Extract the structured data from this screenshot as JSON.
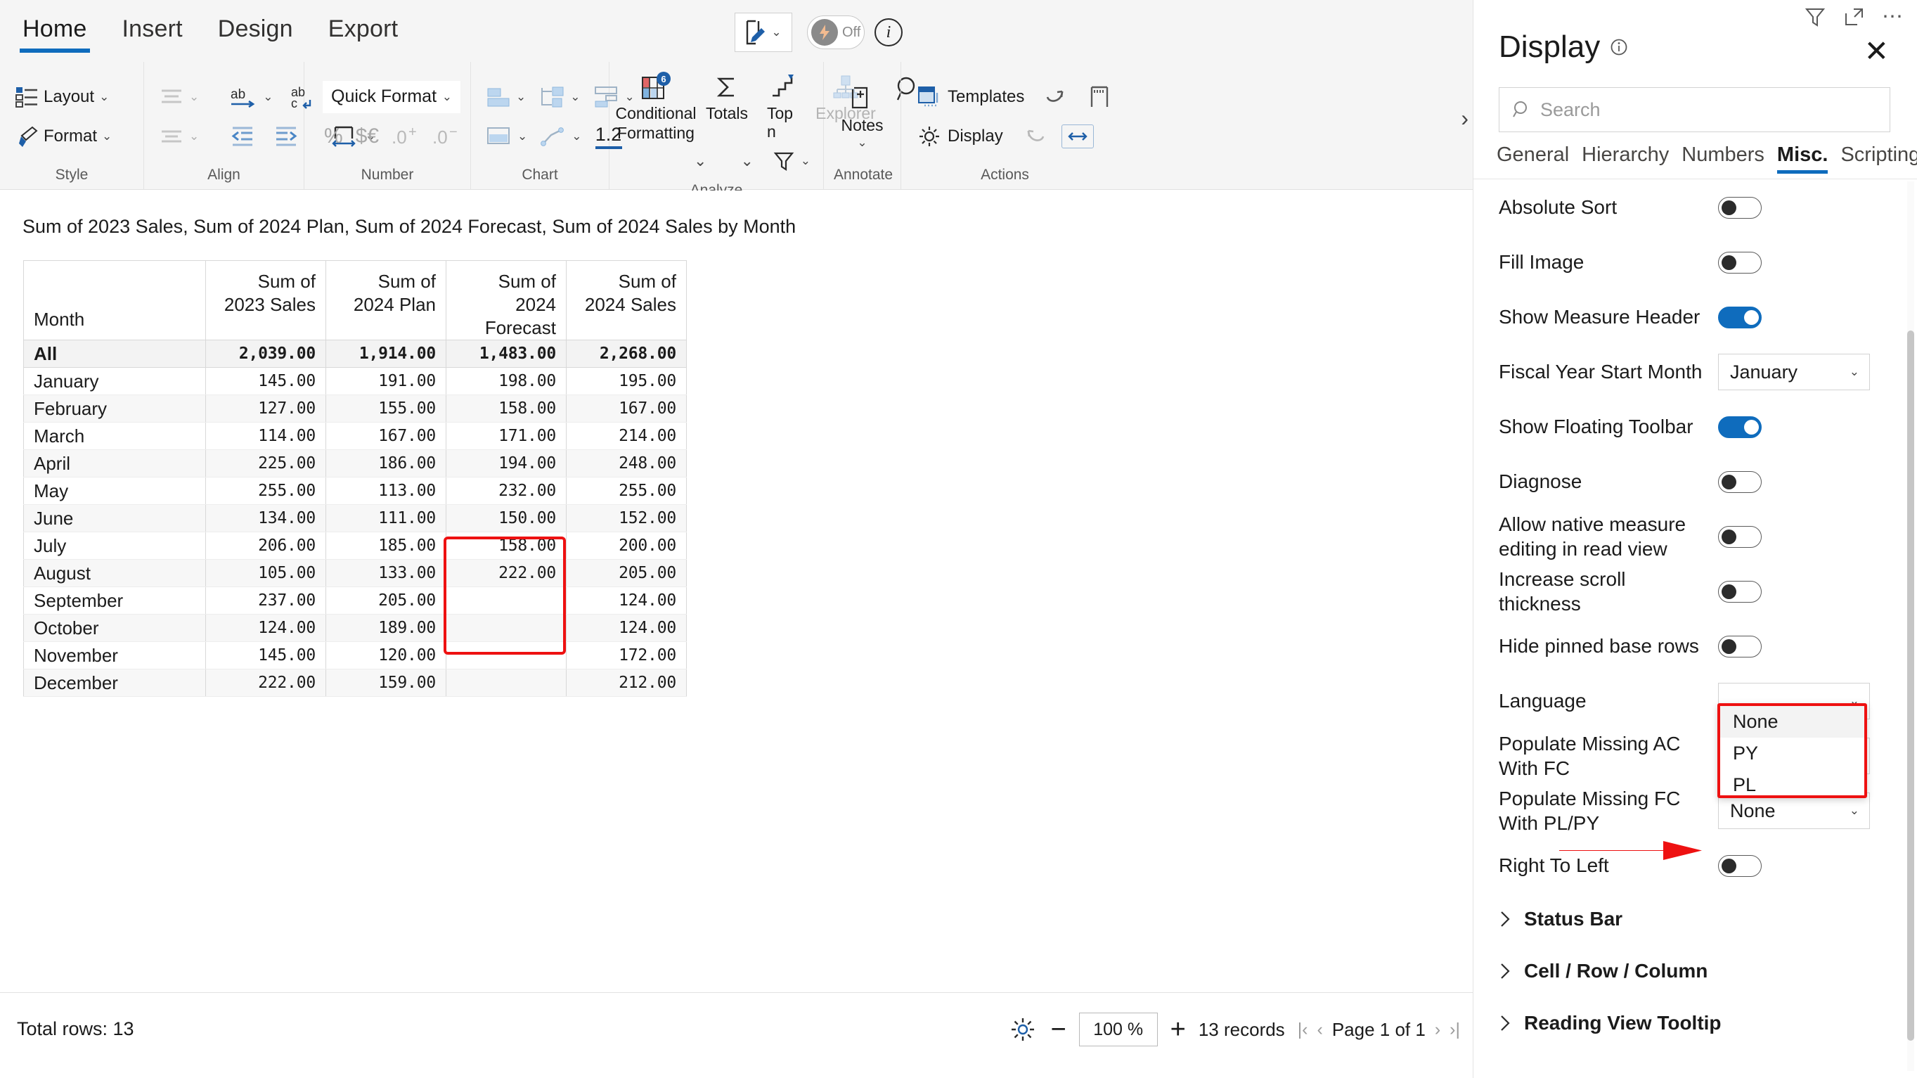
{
  "ribbon": {
    "tabs": [
      {
        "label": "Home",
        "active": true
      },
      {
        "label": "Insert",
        "active": false
      },
      {
        "label": "Design",
        "active": false
      },
      {
        "label": "Export",
        "active": false
      }
    ],
    "groups": {
      "style": {
        "label": "Style",
        "layout": "Layout",
        "format": "Format"
      },
      "align": {
        "label": "Align",
        "font_size": "18"
      },
      "number": {
        "label": "Number",
        "quick_format": "Quick Format"
      },
      "chart": {
        "label": "Chart",
        "one_two": "1.2"
      },
      "analyze": {
        "label": "Analyze",
        "conditional_formatting": "Conditional Formatting",
        "conditional_badge": "6",
        "totals": "Totals",
        "topn": "Top n",
        "explorer": "Explorer"
      },
      "annotate": {
        "label": "Annotate",
        "notes": "Notes"
      },
      "actions": {
        "label": "Actions",
        "templates": "Templates",
        "display": "Display"
      }
    },
    "quick_toolbar": {
      "off_label": "Off"
    }
  },
  "canvas": {
    "visual_title": "Sum of 2023 Sales, Sum of 2024 Plan, Sum of 2024 Forecast, Sum of 2024 Sales by Month"
  },
  "chart_data": {
    "type": "table",
    "title": "Sum of 2023 Sales, Sum of 2024 Plan, Sum of 2024 Forecast, Sum of 2024 Sales by Month",
    "columns": [
      "Month",
      "Sum of 2023 Sales",
      "Sum of 2024 Plan",
      "Sum of 2024 Forecast",
      "Sum of 2024 Sales"
    ],
    "rows": [
      {
        "month": "All",
        "s2023": "2,039.00",
        "plan": "1,914.00",
        "forecast": "1,483.00",
        "s2024": "2,268.00",
        "total": true
      },
      {
        "month": "January",
        "s2023": "145.00",
        "plan": "191.00",
        "forecast": "198.00",
        "s2024": "195.00"
      },
      {
        "month": "February",
        "s2023": "127.00",
        "plan": "155.00",
        "forecast": "158.00",
        "s2024": "167.00"
      },
      {
        "month": "March",
        "s2023": "114.00",
        "plan": "167.00",
        "forecast": "171.00",
        "s2024": "214.00"
      },
      {
        "month": "April",
        "s2023": "225.00",
        "plan": "186.00",
        "forecast": "194.00",
        "s2024": "248.00"
      },
      {
        "month": "May",
        "s2023": "255.00",
        "plan": "113.00",
        "forecast": "232.00",
        "s2024": "255.00"
      },
      {
        "month": "June",
        "s2023": "134.00",
        "plan": "111.00",
        "forecast": "150.00",
        "s2024": "152.00"
      },
      {
        "month": "July",
        "s2023": "206.00",
        "plan": "185.00",
        "forecast": "158.00",
        "s2024": "200.00"
      },
      {
        "month": "August",
        "s2023": "105.00",
        "plan": "133.00",
        "forecast": "222.00",
        "s2024": "205.00"
      },
      {
        "month": "September",
        "s2023": "237.00",
        "plan": "205.00",
        "forecast": "",
        "s2024": "124.00"
      },
      {
        "month": "October",
        "s2023": "124.00",
        "plan": "189.00",
        "forecast": "",
        "s2024": "124.00"
      },
      {
        "month": "November",
        "s2023": "145.00",
        "plan": "120.00",
        "forecast": "",
        "s2024": "172.00"
      },
      {
        "month": "December",
        "s2023": "222.00",
        "plan": "159.00",
        "forecast": "",
        "s2024": "212.00"
      }
    ],
    "highlight": "Sum of 2024 Forecast column, September–December (empty cells)",
    "notes": "Values shown with 2 decimals; 'All' row is the bold grand total row."
  },
  "statusbar": {
    "total_rows": "Total rows: 13",
    "zoom": "100 %",
    "minus": "−",
    "plus": "+",
    "records": "13 records",
    "page": "Page 1 of 1",
    "first": "|‹",
    "prev": "‹",
    "next": "›",
    "last": "›|"
  },
  "panel": {
    "title": "Display",
    "close": "✕",
    "search_placeholder": "Search",
    "tabs": [
      {
        "label": "General",
        "active": false
      },
      {
        "label": "Hierarchy",
        "active": false
      },
      {
        "label": "Numbers",
        "active": false
      },
      {
        "label": "Misc.",
        "active": true
      },
      {
        "label": "Scripting",
        "active": false
      }
    ],
    "settings": [
      {
        "label": "Absolute Sort",
        "type": "toggle",
        "value": "off"
      },
      {
        "label": "Fill Image",
        "type": "toggle",
        "value": "off"
      },
      {
        "label": "Show Measure Header",
        "type": "toggle",
        "value": "on"
      },
      {
        "label": "Fiscal Year Start Month",
        "type": "select",
        "value": "January"
      },
      {
        "label": "Show Floating Toolbar",
        "type": "toggle",
        "value": "on"
      },
      {
        "label": "Diagnose",
        "type": "toggle",
        "value": "off"
      },
      {
        "label": "Allow native measure editing in read view",
        "type": "toggle",
        "value": "off"
      },
      {
        "label": "Increase scroll thickness",
        "type": "toggle",
        "value": "off"
      },
      {
        "label": "Hide pinned base rows",
        "type": "toggle",
        "value": "off"
      },
      {
        "label": "Language",
        "type": "select",
        "value": ""
      },
      {
        "label": "Populate Missing AC With FC",
        "type": "select",
        "value": ""
      },
      {
        "label": "Populate Missing FC With PL/PY",
        "type": "select",
        "value": "None"
      },
      {
        "label": "Right To Left",
        "type": "toggle",
        "value": "off"
      }
    ],
    "open_dropdown": {
      "options": [
        "None",
        "PY",
        "PL"
      ],
      "selected": "None"
    },
    "sections": [
      {
        "label": "Status Bar"
      },
      {
        "label": "Cell / Row / Column"
      },
      {
        "label": "Reading View Tooltip"
      }
    ]
  },
  "colors": {
    "accent": "#0f6cbd",
    "highlight_red": "#ee1111",
    "toggle_on": "#0f6cbd",
    "panel_border": "#e3e3e3"
  }
}
